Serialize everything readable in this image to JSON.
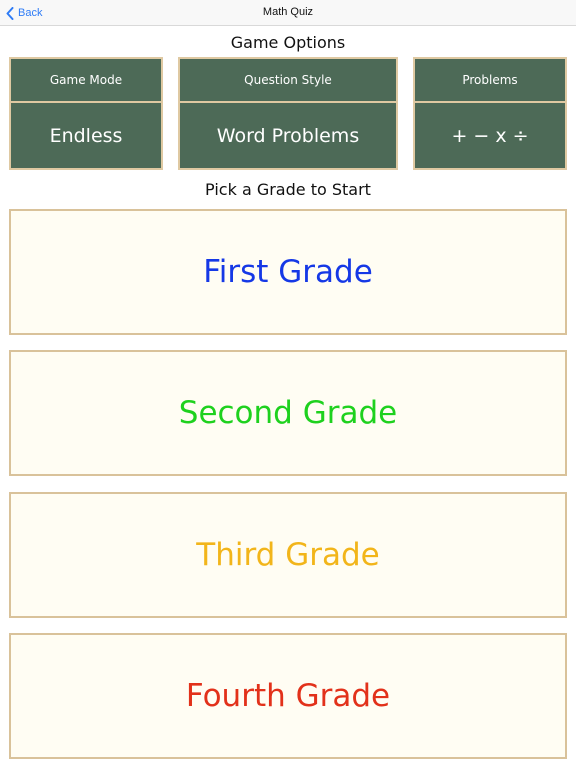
{
  "navbar": {
    "back_label": "Back",
    "title": "Math Quiz"
  },
  "game_options": {
    "heading": "Game Options",
    "options": [
      {
        "label": "Game Mode",
        "value": "Endless"
      },
      {
        "label": "Question Style",
        "value": "Word Problems"
      },
      {
        "label": "Problems",
        "value": "+ − x ÷"
      }
    ]
  },
  "grade_picker": {
    "heading": "Pick a Grade to Start",
    "grades": [
      {
        "label": "First Grade",
        "color": "#1538e6"
      },
      {
        "label": "Second Grade",
        "color": "#1ed11e"
      },
      {
        "label": "Third Grade",
        "color": "#f2b51a"
      },
      {
        "label": "Fourth Grade",
        "color": "#e2311a"
      }
    ]
  },
  "colors": {
    "accent": "#2f7cf6",
    "option_bg": "#4d6a57",
    "option_border": "#dfc9a2",
    "grade_bg": "#fffdf3",
    "grade_border": "#d9c29a"
  }
}
